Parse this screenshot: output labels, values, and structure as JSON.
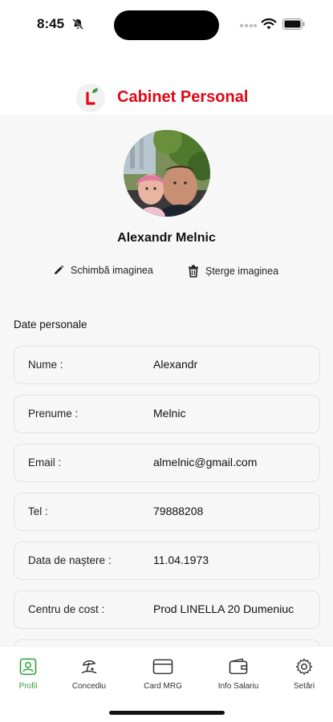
{
  "status_bar": {
    "time": "8:45"
  },
  "header": {
    "title": "Cabinet Personal"
  },
  "profile": {
    "name": "Alexandr Melnic",
    "change_image_label": "Schimbă imaginea",
    "delete_image_label": "Șterge imaginea"
  },
  "personal": {
    "section_title": "Date personale",
    "fields": [
      {
        "label": "Nume :",
        "value": "Alexandr"
      },
      {
        "label": "Prenume :",
        "value": "Melnic"
      },
      {
        "label": "Email :",
        "value": "almelnic@gmail.com"
      },
      {
        "label": "Tel :",
        "value": "79888208"
      },
      {
        "label": "Data de naștere :",
        "value": "11.04.1973"
      },
      {
        "label": "Centru de cost :",
        "value": "Prod LINELLA 20 Dumeniuc"
      }
    ]
  },
  "nav": {
    "items": [
      {
        "label": "Profil",
        "icon": "profile-icon",
        "active": true
      },
      {
        "label": "Concediu",
        "icon": "beach-umbrella-icon",
        "active": false
      },
      {
        "label": "Card MRG",
        "icon": "card-icon",
        "active": false
      },
      {
        "label": "Info Salariu",
        "icon": "wallet-icon",
        "active": false
      },
      {
        "label": "Setări",
        "icon": "gear-icon",
        "active": false
      }
    ],
    "active_color": "#2e9e3a"
  },
  "colors": {
    "brand": "#e30613",
    "accent": "#2e9e3a"
  }
}
